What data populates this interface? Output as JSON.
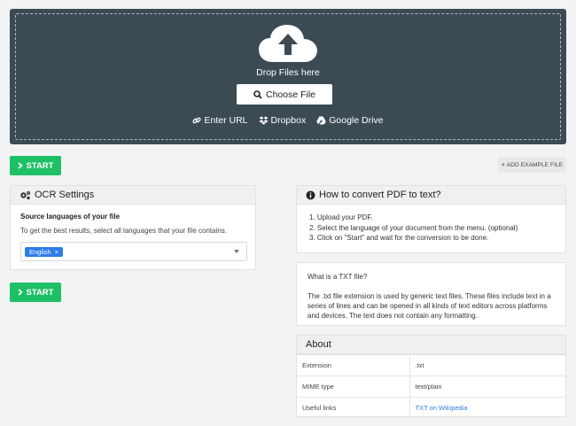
{
  "upload": {
    "drop_text": "Drop Files here",
    "choose_label": "Choose File",
    "sources": [
      {
        "icon": "link-icon",
        "label": "Enter URL"
      },
      {
        "icon": "dropbox-icon",
        "label": "Dropbox"
      },
      {
        "icon": "google-drive-icon",
        "label": "Google Drive"
      }
    ]
  },
  "actions": {
    "start_label": "START",
    "add_example_label": "ADD EXAMPLE FILE"
  },
  "ocr": {
    "title": "OCR Settings",
    "source_title": "Source languages of your file",
    "description": "To get the best results, select all languages that your file contains.",
    "selected_language": "English",
    "remove_symbol": "×"
  },
  "howto": {
    "title": "How to convert PDF to text?",
    "steps": [
      "1. Upload your PDF.",
      "2. Select the language of your document from the menu. (optional)",
      "3. Click on \"Start\" and wait for the conversion to be done."
    ]
  },
  "txtinfo": {
    "question": "What is a TXT file?",
    "body": "The .txt file extension is used by generic text files. These files include text in a series of lines and can be opened in all kinds of text editors across platforms and devices. The text does not contain any formatting."
  },
  "about": {
    "title": "About",
    "rows": [
      {
        "label": "Extension",
        "value": ".txt"
      },
      {
        "label": "MIME type",
        "value": "text/plain"
      },
      {
        "label": "Useful links",
        "value_prefix": "TXT on ",
        "link": "Wikipedia"
      }
    ]
  },
  "colors": {
    "upload_bg": "#3c4a54",
    "start_green": "#1fc065",
    "tag_blue": "#2e7ce8"
  }
}
